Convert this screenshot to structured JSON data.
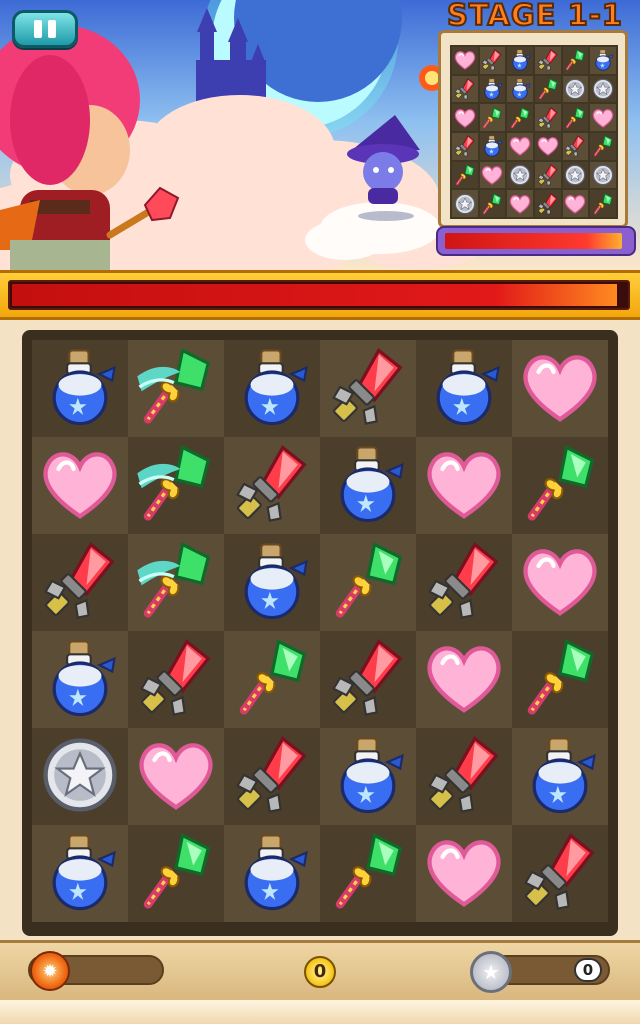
{
  "hud": {
    "stage_label": "STAGE 1-1",
    "score": "0",
    "coin_count": "0"
  },
  "player_hp": 0.985,
  "enemy_hp": 0.97,
  "icons": {
    "pause": "pause-icon",
    "skill": "fire-skill-icon",
    "coin": "silver-star-coin-icon"
  },
  "colors": {
    "hp_red": "#e21919",
    "hp_band": "#f8b71a",
    "pause_teal": "#1f9aa8",
    "board_bg": "#3a2e1f"
  },
  "board": [
    [
      "potion",
      "feather",
      "potion",
      "sword",
      "potion",
      "heart"
    ],
    [
      "heart",
      "feather",
      "sword",
      "potion",
      "heart",
      "wand"
    ],
    [
      "sword",
      "feather",
      "potion",
      "wand",
      "sword",
      "heart"
    ],
    [
      "potion",
      "sword",
      "wand",
      "sword",
      "heart",
      "wand"
    ],
    [
      "coin",
      "heart",
      "sword",
      "potion",
      "sword",
      "potion"
    ],
    [
      "potion",
      "wand",
      "potion",
      "wand",
      "heart",
      "sword"
    ]
  ],
  "minimap": [
    [
      "heart",
      "sword",
      "potion",
      "sword",
      "wand",
      "potion"
    ],
    [
      "sword",
      "potion",
      "potion",
      "wand",
      "coin",
      "coin"
    ],
    [
      "heart",
      "wand",
      "wand",
      "sword",
      "wand",
      "heart"
    ],
    [
      "sword",
      "potion",
      "heart",
      "heart",
      "sword",
      "wand"
    ],
    [
      "wand",
      "heart",
      "coin",
      "sword",
      "coin",
      "coin"
    ],
    [
      "coin",
      "wand",
      "heart",
      "sword",
      "heart",
      "wand"
    ]
  ]
}
